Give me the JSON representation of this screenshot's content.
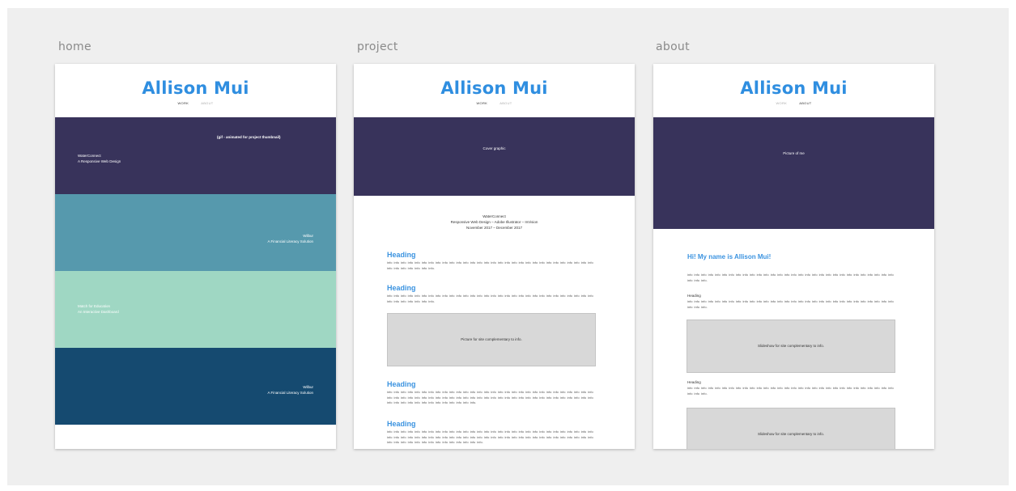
{
  "artboards": {
    "home_label": "home",
    "project_label": "project",
    "about_label": "about"
  },
  "site": {
    "title": "Allison Mui",
    "nav_work": "WORK",
    "nav_about": "ABOUT"
  },
  "home": {
    "s1_note": "(gif - animated for project thumbnail)",
    "s1_title": "WaterConnect",
    "s1_sub": "A Responsive Web Design",
    "s2_title": "Wilbur",
    "s2_sub": "A Financial Literacy Solution",
    "s3_title": "Match for Education",
    "s3_sub": "An Interactive Dashboard",
    "s4_title": "Wilbur",
    "s4_sub": "A Financial Literacy Solution",
    "colors": [
      "#38335b",
      "#5699ad",
      "#9fd7c3",
      "#154a70"
    ]
  },
  "project": {
    "cover": "Cover graphic",
    "meta_title": "WaterConnect",
    "meta_tools": "Responsive Web Design – Adobe Illustrator – InVision",
    "meta_dates": "November 2017 – December 2017",
    "heading1": "Heading",
    "heading2": "Heading",
    "heading3": "Heading",
    "heading4": "Heading",
    "body1": "info info info info info info info info info info info info info info info info info info info info info info info info info info info info info info info info info info info info info.",
    "body2": "info info info info info info info info info info info info info info info info info info info info info info info info info info info info info info info info info info info info info.",
    "body3": "info info info info info info info info info info info info info info info info info info info info info info info info info info info info info info info info info info info info info info info info info info info info info info info info info info info info info info info info info info info info info info info info info info info info info info info info info.",
    "body4": "info info info info info info info info info info info info info info info info info info info info info info info info info info info info info info info info info info info info info info info info info info info info info info info info info info info info info info info info info info info info info info info info info info info info info info info info info info.",
    "picture": "Picture for site complementary to info."
  },
  "about": {
    "picture": "Picture of me",
    "greeting": "Hi! My name is Allison Mui!",
    "intro": "info info info info info info info info info info info info info info info info info info info info info info info info info info info info info info info info info.",
    "heading1": "Heading",
    "body1": "info info info info info info info info info info info info info info info info info info info info info info info info info info info info info info info info info.",
    "slideshow1": "Slideshow for site complementary to info.",
    "heading2": "Heading",
    "body2": "info info info info info info info info info info info info info info info info info info info info info info info info info info info info info info info info info.",
    "slideshow2": "Slideshow for site complementary to info."
  }
}
